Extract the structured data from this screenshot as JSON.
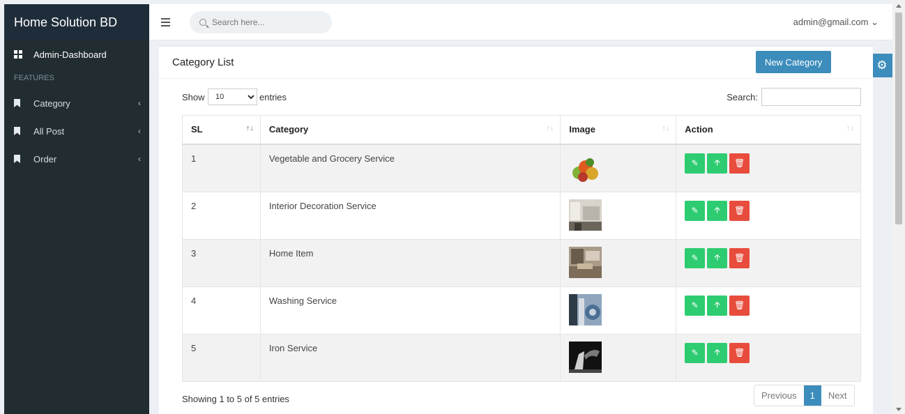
{
  "sidebar": {
    "brand": "Home Solution BD",
    "dashboard": "Admin-Dashboard",
    "section": "FEATURES",
    "items": [
      {
        "label": "Category"
      },
      {
        "label": "All Post"
      },
      {
        "label": "Order"
      }
    ]
  },
  "topbar": {
    "search_placeholder": "Search here...",
    "user": "admin@gmail.com ⌄"
  },
  "page": {
    "title": "Category List",
    "new_button": "New Category"
  },
  "controls": {
    "show": "Show",
    "length_value": "10",
    "entries": "entries",
    "search": "Search:"
  },
  "table": {
    "headers": [
      "SL",
      "Category",
      "Image",
      "Action"
    ],
    "rows": [
      {
        "sl": "1",
        "category": "Vegetable and Grocery Service"
      },
      {
        "sl": "2",
        "category": "Interior Decoration Service"
      },
      {
        "sl": "3",
        "category": "Home Item"
      },
      {
        "sl": "4",
        "category": "Washing Service"
      },
      {
        "sl": "5",
        "category": "Iron Service"
      }
    ]
  },
  "footer": {
    "info": "Showing 1 to 5 of 5 entries",
    "previous": "Previous",
    "page": "1",
    "next": "Next"
  },
  "colors": {
    "sidebar": "#222d32",
    "primary": "#3c8dbc",
    "success": "#2ecc71",
    "danger": "#e74c3c"
  }
}
